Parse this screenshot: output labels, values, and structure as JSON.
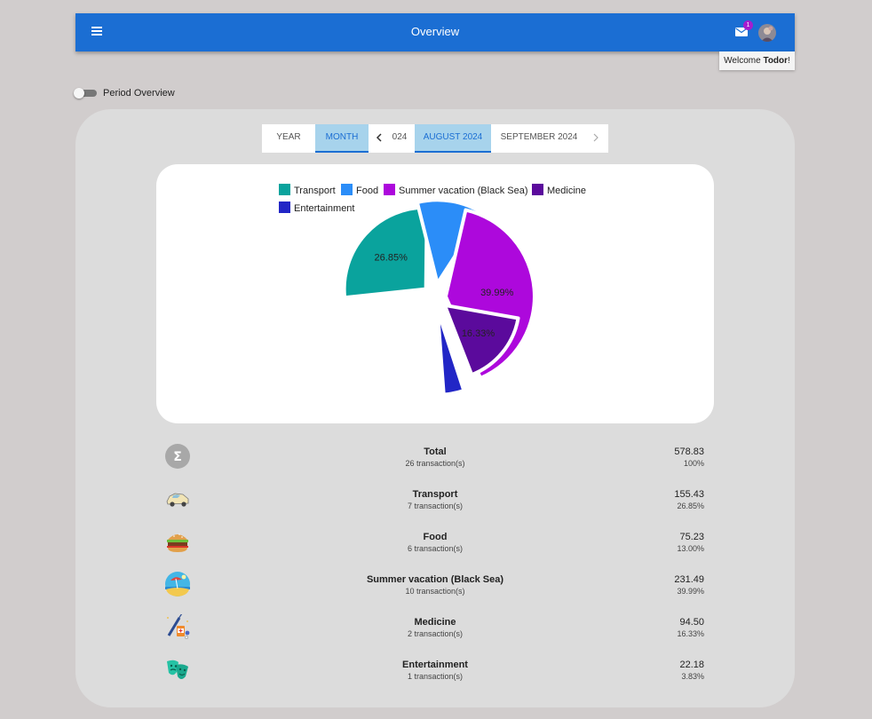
{
  "appbar": {
    "title": "Overview",
    "mail_badge": "1"
  },
  "welcome": {
    "prefix": "Welcome ",
    "user": "Todor",
    "suffix": "!"
  },
  "period_toggle": {
    "label": "Period Overview"
  },
  "tabs": {
    "year": "YEAR",
    "month": "MONTH",
    "prev_month_partial": "024",
    "current": "AUGUST 2024",
    "next": "SEPTEMBER 2024"
  },
  "colors": {
    "Transport": "#0aa39d",
    "Food": "#2b8df8",
    "Summer vacation (Black Sea)": "#ad08dc",
    "Medicine": "#5b0a9c",
    "Entertainment": "#2226c6"
  },
  "chart_data": {
    "type": "pie",
    "legend_position": "top",
    "slices": [
      {
        "label": "Transport",
        "value": 155.43,
        "percent": 26.85,
        "display": "26.85%"
      },
      {
        "label": "Food",
        "value": 75.23,
        "percent": 13.0,
        "display": ""
      },
      {
        "label": "Summer vacation (Black Sea)",
        "value": 231.49,
        "percent": 39.99,
        "display": "39.99%"
      },
      {
        "label": "Medicine",
        "value": 94.5,
        "percent": 16.33,
        "display": "16.33%"
      },
      {
        "label": "Entertainment",
        "value": 22.18,
        "percent": 3.83,
        "display": ""
      }
    ]
  },
  "summary": [
    {
      "icon": "sigma-icon",
      "name": "Total",
      "count": "26 transaction(s)",
      "amount": "578.83",
      "pct": "100%"
    },
    {
      "icon": "car-icon",
      "name": "Transport",
      "count": "7 transaction(s)",
      "amount": "155.43",
      "pct": "26.85%"
    },
    {
      "icon": "burger-icon",
      "name": "Food",
      "count": "6 transaction(s)",
      "amount": "75.23",
      "pct": "13.00%"
    },
    {
      "icon": "beach-icon",
      "name": "Summer vacation (Black Sea)",
      "count": "10 transaction(s)",
      "amount": "231.49",
      "pct": "39.99%"
    },
    {
      "icon": "medicine-icon",
      "name": "Medicine",
      "count": "2 transaction(s)",
      "amount": "94.50",
      "pct": "16.33%"
    },
    {
      "icon": "theater-masks-icon",
      "name": "Entertainment",
      "count": "1 transaction(s)",
      "amount": "22.18",
      "pct": "3.83%"
    }
  ]
}
